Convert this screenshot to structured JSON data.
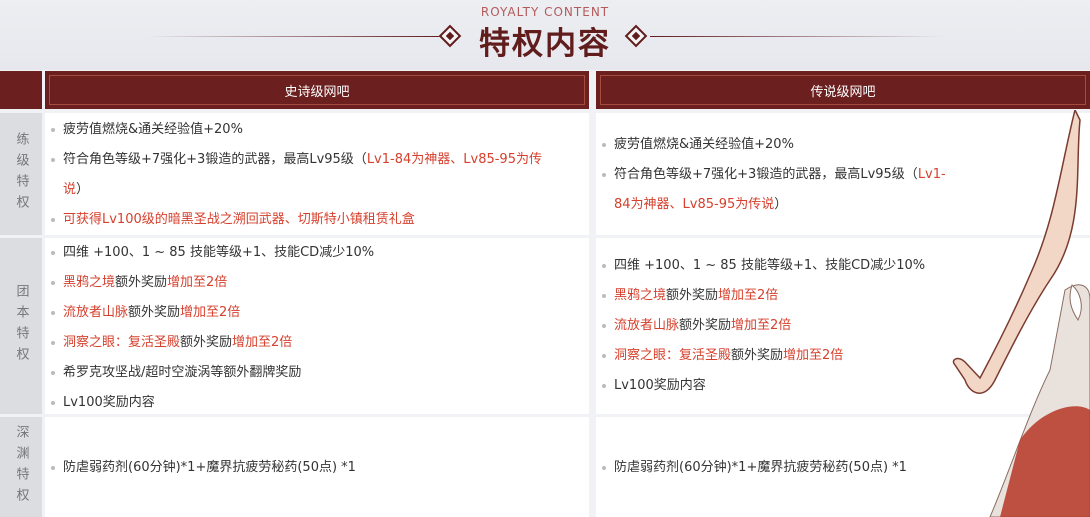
{
  "header": {
    "subtitle": "ROYALTY CONTENT",
    "title": "特权内容"
  },
  "columns": [
    "史诗级网吧",
    "传说级网吧"
  ],
  "rows": [
    {
      "label": "练级特权",
      "col1": [
        {
          "parts": [
            {
              "t": "疲劳值燃烧&通关经验值+20%",
              "red": false
            }
          ]
        },
        {
          "parts": [
            {
              "t": "符合角色等级+7强化+3锻造的武器，最高Lv95级（",
              "red": false
            },
            {
              "t": "Lv1-84为神器、Lv85-95为传",
              "red": true
            }
          ]
        },
        {
          "parts": [
            {
              "t": "说",
              "red": true
            },
            {
              "t": "）",
              "red": false
            }
          ],
          "cont": true
        },
        {
          "parts": [
            {
              "t": "可获得Lv100级的暗黑圣战之溯回武器、切斯特小镇租赁礼盒",
              "red": true
            }
          ]
        }
      ],
      "col2": [
        {
          "parts": [
            {
              "t": "疲劳值燃烧&通关经验值+20%",
              "red": false
            }
          ]
        },
        {
          "parts": [
            {
              "t": "符合角色等级+7强化+3锻造的武器，最高Lv95级（",
              "red": false
            },
            {
              "t": "Lv1-",
              "red": true
            }
          ]
        },
        {
          "parts": [
            {
              "t": "84为神器、Lv85-95为传说",
              "red": true
            },
            {
              "t": "）",
              "red": false
            }
          ],
          "cont": true
        }
      ]
    },
    {
      "label": "团本特权",
      "col1": [
        {
          "parts": [
            {
              "t": "四维 +100、1 ~ 85 技能等级+1、技能CD减少10%",
              "red": false
            }
          ]
        },
        {
          "parts": [
            {
              "t": "黑鸦之境",
              "red": true
            },
            {
              "t": "额外奖励",
              "red": false
            },
            {
              "t": "增加至2倍",
              "red": true
            }
          ]
        },
        {
          "parts": [
            {
              "t": "流放者山脉",
              "red": true
            },
            {
              "t": "额外奖励",
              "red": false
            },
            {
              "t": "增加至2倍",
              "red": true
            }
          ]
        },
        {
          "parts": [
            {
              "t": "洞察之眼：复活圣殿",
              "red": true
            },
            {
              "t": "额外奖励",
              "red": false
            },
            {
              "t": "增加至2倍",
              "red": true
            }
          ]
        },
        {
          "parts": [
            {
              "t": "希罗克攻坚战/超时空漩涡等额外翻牌奖励",
              "red": false
            }
          ]
        },
        {
          "parts": [
            {
              "t": "Lv100奖励内容",
              "red": false
            }
          ]
        }
      ],
      "col2": [
        {
          "parts": [
            {
              "t": "四维 +100、1 ~ 85 技能等级+1、技能CD减少10%",
              "red": false
            }
          ]
        },
        {
          "parts": [
            {
              "t": "黑鸦之境",
              "red": true
            },
            {
              "t": "额外奖励",
              "red": false
            },
            {
              "t": "增加至2倍",
              "red": true
            }
          ]
        },
        {
          "parts": [
            {
              "t": "流放者山脉",
              "red": true
            },
            {
              "t": "额外奖励",
              "red": false
            },
            {
              "t": "增加至2倍",
              "red": true
            }
          ]
        },
        {
          "parts": [
            {
              "t": "洞察之眼：复活圣殿",
              "red": true
            },
            {
              "t": "额外奖励",
              "red": false
            },
            {
              "t": "增加至2倍",
              "red": true
            }
          ]
        },
        {
          "parts": [
            {
              "t": "Lv100奖励内容",
              "red": false
            }
          ]
        }
      ]
    },
    {
      "label": "深渊特权",
      "col1": [
        {
          "parts": [
            {
              "t": "防虐弱药剂(60分钟)*1+魔界抗疲劳秘药(50点) *1",
              "red": false
            }
          ]
        }
      ],
      "col2": [
        {
          "parts": [
            {
              "t": "防虐弱药剂(60分钟)*1+魔界抗疲劳秘药(50点) *1",
              "red": false
            }
          ]
        }
      ]
    }
  ],
  "colors": {
    "header_bar": "#6b1f1f",
    "accent_red": "#d6402d",
    "title": "#611c1c"
  }
}
